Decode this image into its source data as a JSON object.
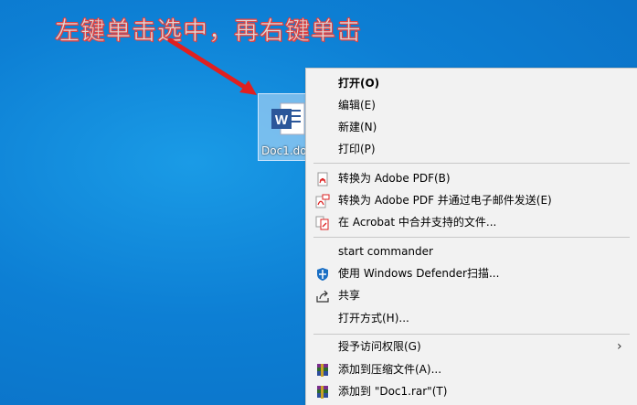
{
  "annotation": "左键单击选中，再右键单击",
  "file": {
    "name": "Doc1.do",
    "icon": "word-document-icon"
  },
  "menu": {
    "items": [
      {
        "label": "打开(O)"
      },
      {
        "label": "编辑(E)"
      },
      {
        "label": "新建(N)"
      },
      {
        "label": "打印(P)"
      },
      {
        "label": "转换为 Adobe PDF(B)",
        "icon": "adobe-pdf-icon"
      },
      {
        "label": "转换为 Adobe PDF 并通过电子邮件发送(E)",
        "icon": "adobe-pdf-email-icon"
      },
      {
        "label": "在 Acrobat 中合并支持的文件...",
        "icon": "acrobat-combine-icon"
      },
      {
        "label": "start commander"
      },
      {
        "label": "使用 Windows Defender扫描...",
        "icon": "windows-defender-icon"
      },
      {
        "label": "共享",
        "icon": "share-icon"
      },
      {
        "label": "打开方式(H)..."
      },
      {
        "label": "授予访问权限(G)"
      },
      {
        "label": "添加到压缩文件(A)...",
        "icon": "winrar-icon"
      },
      {
        "label": "添加到 \"Doc1.rar\"(T)",
        "icon": "winrar-icon"
      }
    ]
  },
  "colors": {
    "desktop": "#0d7fd4",
    "annotation_stroke": "#e04040",
    "menu_bg": "#f2f2f2"
  }
}
